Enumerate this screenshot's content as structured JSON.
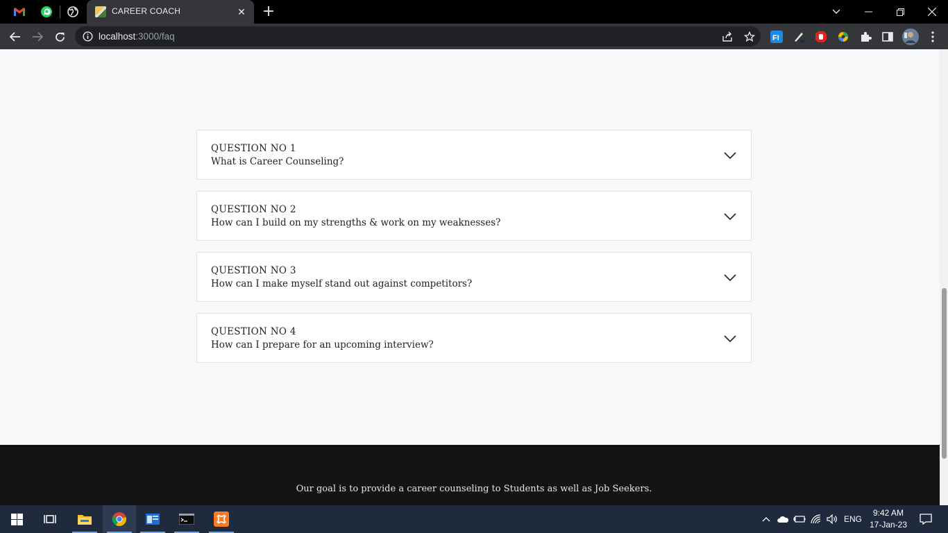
{
  "browser": {
    "tab_title": "CAREER COACH",
    "url_host": "localhost",
    "url_path": ":3000/faq"
  },
  "faq": [
    {
      "number": "QUESTION NO 1",
      "question": "What is Career Counseling?"
    },
    {
      "number": "QUESTION NO 2",
      "question": "How can I build on my strengths & work on my weaknesses?"
    },
    {
      "number": "QUESTION NO 3",
      "question": "How can I make myself stand out against competitors?"
    },
    {
      "number": "QUESTION NO 4",
      "question": "How can I prepare for an upcoming interview?"
    }
  ],
  "footer": {
    "goal": "Our goal is to provide a career counseling to Students as well as Job Seekers."
  },
  "taskbar": {
    "language": "ENG",
    "time": "9:42 AM",
    "date": "17-Jan-23"
  }
}
